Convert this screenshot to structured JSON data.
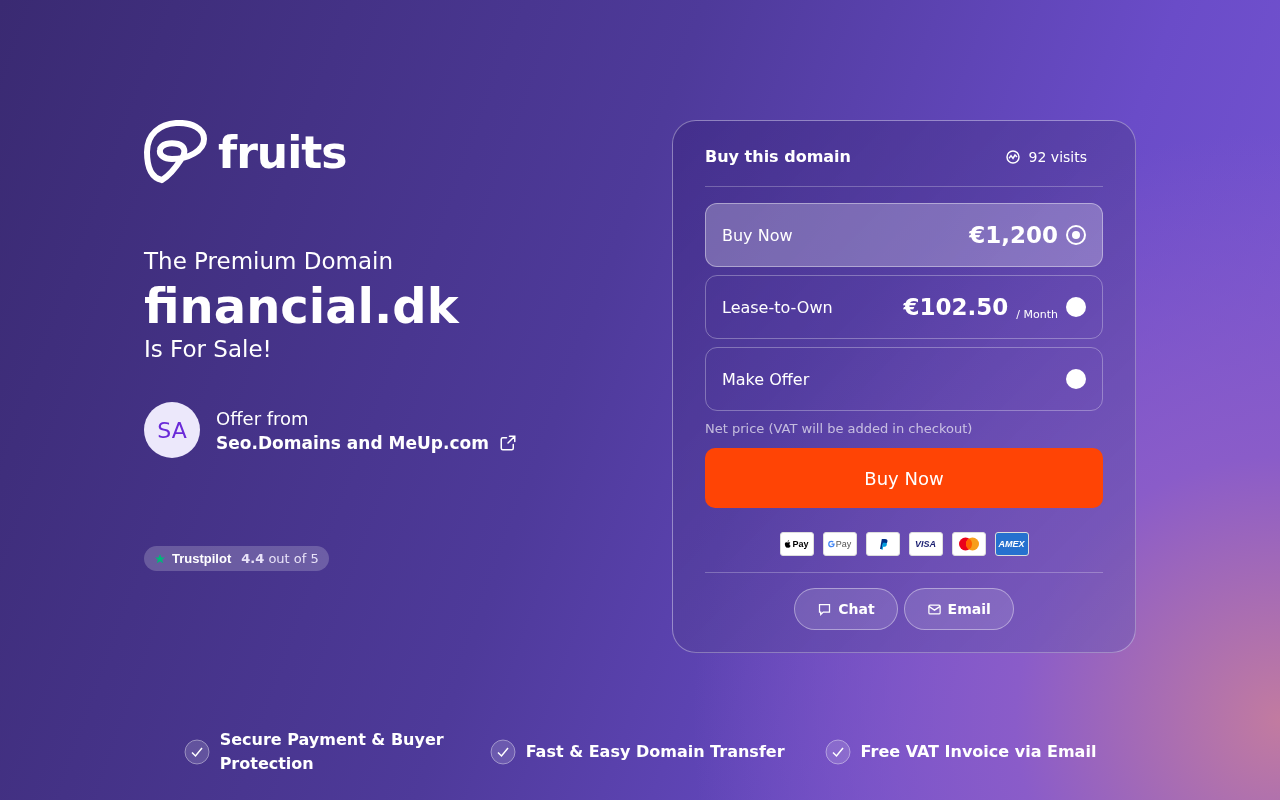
{
  "brand": {
    "name": "fruits"
  },
  "hero": {
    "kicker": "The Premium Domain",
    "domain": "financial.dk",
    "tagline": "Is For Sale!"
  },
  "seller": {
    "initials": "SA",
    "label": "Offer from",
    "name": "Seo.Domains and MeUp.com"
  },
  "rating": {
    "source": "Trustpilot",
    "text": "**4.4** out of 5"
  },
  "card": {
    "title": "Buy this domain",
    "visits": "92 visits",
    "options": [
      {
        "label": "Buy Now",
        "price": "€1,200",
        "selected": true
      },
      {
        "label": "Lease-to-Own",
        "price": "€102.50",
        "unit": "/ Month",
        "selected": false
      },
      {
        "label": "Make Offer",
        "selected": false
      }
    ],
    "note": "Net price (VAT will be added in checkout)",
    "cta": "Buy Now",
    "payment_methods": [
      {
        "kind": "apple",
        "label": "Pay"
      },
      {
        "kind": "google",
        "label": "Pay"
      },
      {
        "kind": "paypal"
      },
      {
        "kind": "visa",
        "label": "VISA"
      },
      {
        "kind": "mastercard"
      },
      {
        "kind": "amex",
        "label": "AMEX"
      }
    ],
    "contacts": [
      {
        "kind": "chat",
        "label": "Chat"
      },
      {
        "kind": "email",
        "label": "Email"
      }
    ]
  },
  "features": [
    "Secure Payment & Buyer Protection",
    "Fast & Easy Domain Transfer",
    "Free VAT Invoice via Email"
  ]
}
